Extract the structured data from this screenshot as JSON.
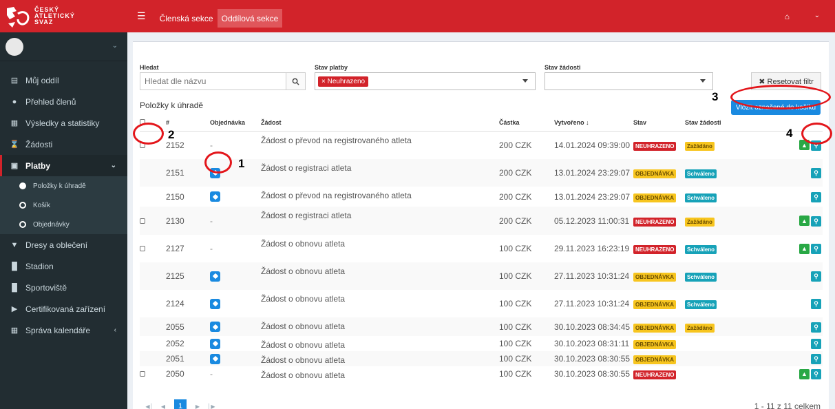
{
  "logo": {
    "text1": "ČESKÝ",
    "text2": "ATLETICKÝ",
    "text3": "SVAZ"
  },
  "topbar": {
    "tab1": "Členská sekce",
    "tab2": "Oddílová sekce"
  },
  "sidebar": {
    "items": [
      {
        "label": "Můj oddíl",
        "icon": "id-card-icon"
      },
      {
        "label": "Přehled členů",
        "icon": "users-icon"
      },
      {
        "label": "Výsledky a statistiky",
        "icon": "table-icon"
      },
      {
        "label": "Žádosti",
        "icon": "hourglass-icon"
      },
      {
        "label": "Platby",
        "icon": "money-icon"
      },
      {
        "label": "Dresy a oblečení",
        "icon": "shield-icon"
      },
      {
        "label": "Stadion",
        "icon": "building-icon"
      },
      {
        "label": "Sportoviště",
        "icon": "building-icon"
      },
      {
        "label": "Certifikovaná zařízení",
        "icon": "video-icon"
      },
      {
        "label": "Správa kalendáře",
        "icon": "calendar-icon"
      }
    ],
    "subitems": [
      {
        "label": "Položky k úhradě"
      },
      {
        "label": "Košík"
      },
      {
        "label": "Objednávky"
      }
    ]
  },
  "filters": {
    "search_label": "Hledat",
    "search_placeholder": "Hledat dle názvu",
    "payment_label": "Stav platby",
    "payment_chip": "× Neuhrazeno",
    "request_label": "Stav žádosti",
    "reset_label": "✖ Resetovat filtr"
  },
  "list": {
    "title": "Položky k úhradě",
    "basket_button": "Vložit označené do košíku",
    "columns": [
      "#",
      "Objednávka",
      "Žádost",
      "Částka",
      "Vytvořeno ↓",
      "Stav",
      "Stav žádosti"
    ],
    "rows": [
      {
        "id": "2152",
        "order": "-",
        "request": "Žádost o převod na registrovaného atleta",
        "amount": "200 CZK",
        "created": "14.01.2024 09:39:00",
        "status": "NEUHRAZENO",
        "req_status": "Zažádáno"
      },
      {
        "id": "2151",
        "order": "tag",
        "request": "Žádost o registraci atleta",
        "amount": "200 CZK",
        "created": "13.01.2024 23:29:07",
        "status": "OBJEDNÁVKA",
        "req_status": "Schváleno"
      },
      {
        "id": "2150",
        "order": "tag",
        "request": "Žádost o převod na registrovaného atleta",
        "amount": "200 CZK",
        "created": "13.01.2024 23:29:07",
        "status": "OBJEDNÁVKA",
        "req_status": "Schváleno"
      },
      {
        "id": "2130",
        "order": "-",
        "request": "Žádost o registraci atleta",
        "amount": "200 CZK",
        "created": "05.12.2023 11:00:31",
        "status": "NEUHRAZENO",
        "req_status": "Zažádáno"
      },
      {
        "id": "2127",
        "order": "-",
        "request": "Žádost o obnovu atleta",
        "amount": "100 CZK",
        "created": "29.11.2023 16:23:19",
        "status": "NEUHRAZENO",
        "req_status": "Schváleno"
      },
      {
        "id": "2125",
        "order": "tag",
        "request": "Žádost o obnovu atleta",
        "amount": "100 CZK",
        "created": "27.11.2023 10:31:24",
        "status": "OBJEDNÁVKA",
        "req_status": "Schváleno"
      },
      {
        "id": "2124",
        "order": "tag",
        "request": "Žádost o obnovu atleta",
        "amount": "100 CZK",
        "created": "27.11.2023 10:31:24",
        "status": "OBJEDNÁVKA",
        "req_status": "Schváleno"
      },
      {
        "id": "2055",
        "order": "tag",
        "request": "Žádost o obnovu atleta",
        "amount": "100 CZK",
        "created": "30.10.2023 08:34:45",
        "status": "OBJEDNÁVKA",
        "req_status": "Zažádáno"
      },
      {
        "id": "2052",
        "order": "tag",
        "request": "Žádost o obnovu atleta",
        "amount": "100 CZK",
        "created": "30.10.2023 08:31:11",
        "status": "OBJEDNÁVKA",
        "req_status": ""
      },
      {
        "id": "2051",
        "order": "tag",
        "request": "Žádost o obnovu atleta",
        "amount": "100 CZK",
        "created": "30.10.2023 08:30:55",
        "status": "OBJEDNÁVKA",
        "req_status": ""
      },
      {
        "id": "2050",
        "order": "-",
        "request": "Žádost o obnovu atleta",
        "amount": "100 CZK",
        "created": "30.10.2023 08:30:55",
        "status": "NEUHRAZENO",
        "req_status": ""
      }
    ]
  },
  "pager": {
    "current": "1",
    "total": "1 - 11 z 11 celkem"
  },
  "annotations": {
    "a1": "1",
    "a2": "2",
    "a3": "3",
    "a4": "4"
  },
  "colors": {
    "brand_red": "#d2232a",
    "primary_blue": "#1a8ae0",
    "sidebar_bg": "#222d32",
    "green": "#29a845",
    "teal": "#17a2b8",
    "yellow": "#f7c51f"
  }
}
